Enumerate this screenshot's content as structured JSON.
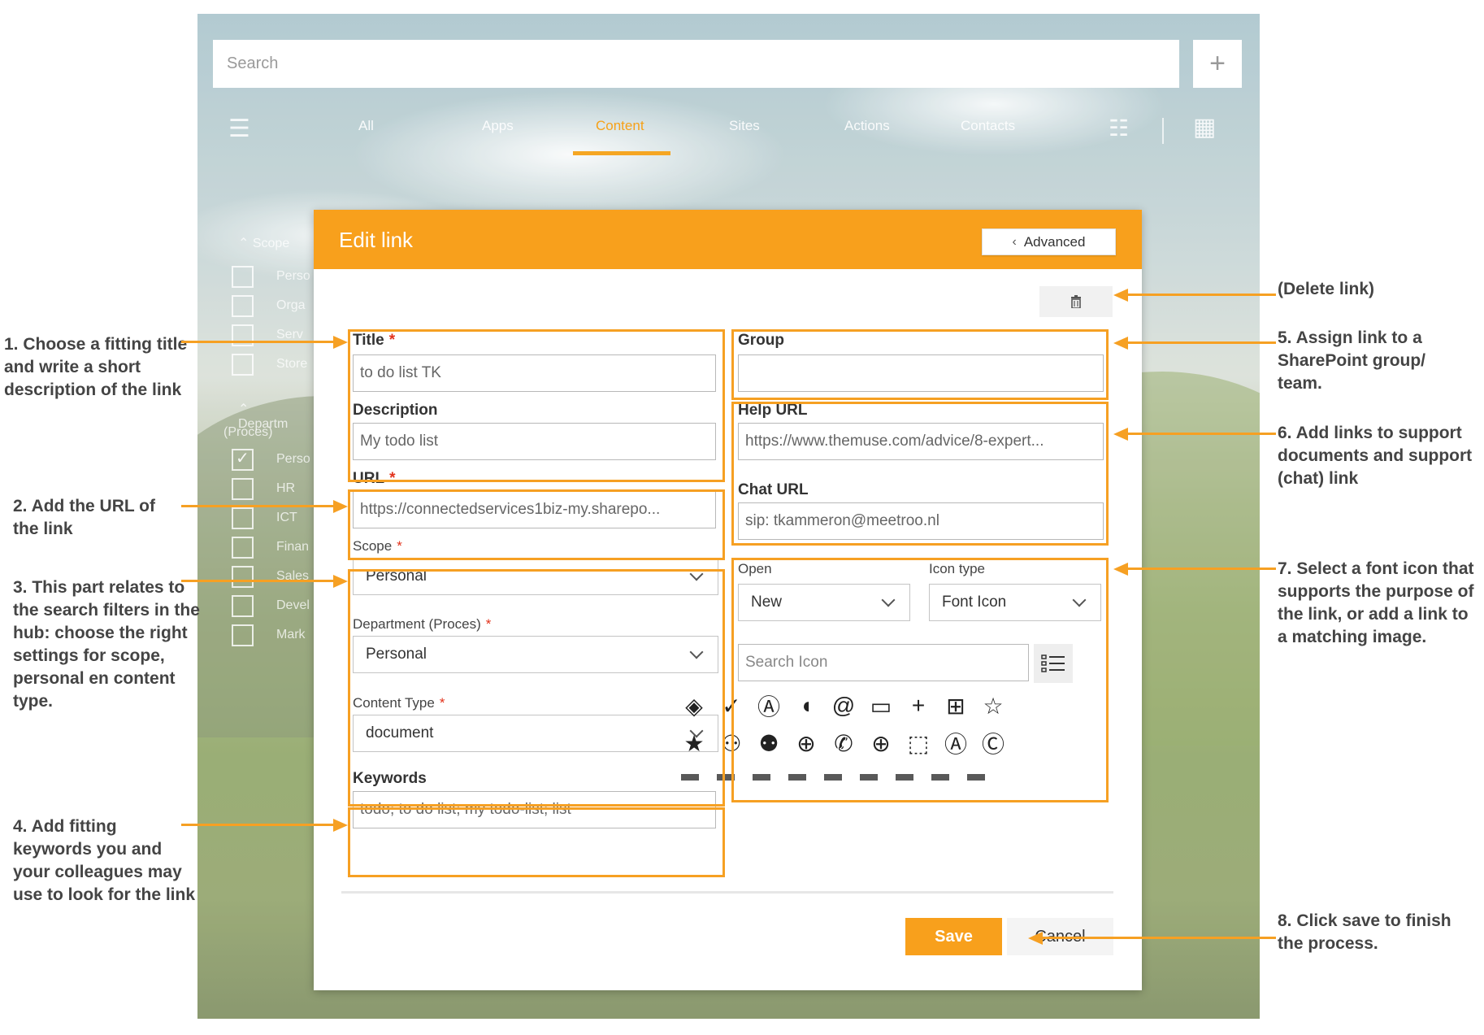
{
  "app": {
    "search_placeholder": "Search",
    "add_label": "+",
    "tabs": [
      "All",
      "Apps",
      "Content",
      "Sites",
      "Actions",
      "Contacts"
    ],
    "active_tab": "Content",
    "filters": {
      "scope_heading": "Scope",
      "scope_items": [
        "Perso",
        "Orga",
        "Serv",
        "Store"
      ],
      "department_heading": "Departm",
      "department_subheading": "(Proces)",
      "department_items": [
        "Perso",
        "HR",
        "ICT",
        "Finan",
        "Sales",
        "Devel",
        "Mark"
      ]
    }
  },
  "dialog": {
    "title": "Edit link",
    "advanced_label": "Advanced",
    "fields": {
      "title_label": "Title",
      "title_value": "to do list TK",
      "description_label": "Description",
      "description_value": "My todo list",
      "url_label": "URL",
      "url_value": "https://connectedservices1biz-my.sharepo...",
      "scope_label": "Scope",
      "scope_value": "Personal",
      "department_label": "Department (Proces)",
      "department_value": "Personal",
      "content_type_label": "Content Type",
      "content_type_value": "document",
      "keywords_label": "Keywords",
      "keywords_value": "todo; to do list; my todo-list; list",
      "group_label": "Group",
      "group_value": "",
      "help_url_label": "Help URL",
      "help_url_value": "https://www.themuse.com/advice/8-expert...",
      "chat_url_label": "Chat URL",
      "chat_url_value": "sip: tkammeron@meetroo.nl",
      "open_label": "Open",
      "open_value": "New",
      "icon_type_label": "Icon type",
      "icon_type_value": "Font Icon",
      "search_icon_placeholder": "Search Icon",
      "required_mark": "*"
    },
    "icons_row1": [
      "◈",
      "✓",
      "Ⓐ",
      "◖",
      "@",
      "▭",
      "+",
      "⊞",
      "☆"
    ],
    "icons_row2": [
      "★",
      "⚇",
      "⚉",
      "⊕",
      "✆",
      "⊕",
      "⬚",
      "Ⓐ",
      "Ⓒ"
    ],
    "save_label": "Save",
    "cancel_label": "Cancel"
  },
  "annotations": {
    "delete": "(Delete link)",
    "a1": "1. Choose a fitting title and write a short description of the link",
    "a2": "2. Add the URL of the link",
    "a3": "3. This part relates to the search filters in the hub: choose the right settings for scope, personal en content type.",
    "a4": "4. Add fitting keywords you and your colleagues may use to look for the link",
    "a5": "5. Assign link to a SharePoint group/ team.",
    "a6": "6. Add links to support documents and support (chat) link",
    "a7": "7. Select a font icon that supports the purpose of the link, or add a link to a matching image.",
    "a8": "8. Click save to finish the process."
  },
  "colors": {
    "accent": "#f8a01c",
    "annotation": "#f6a023",
    "required": "#e2321b"
  }
}
